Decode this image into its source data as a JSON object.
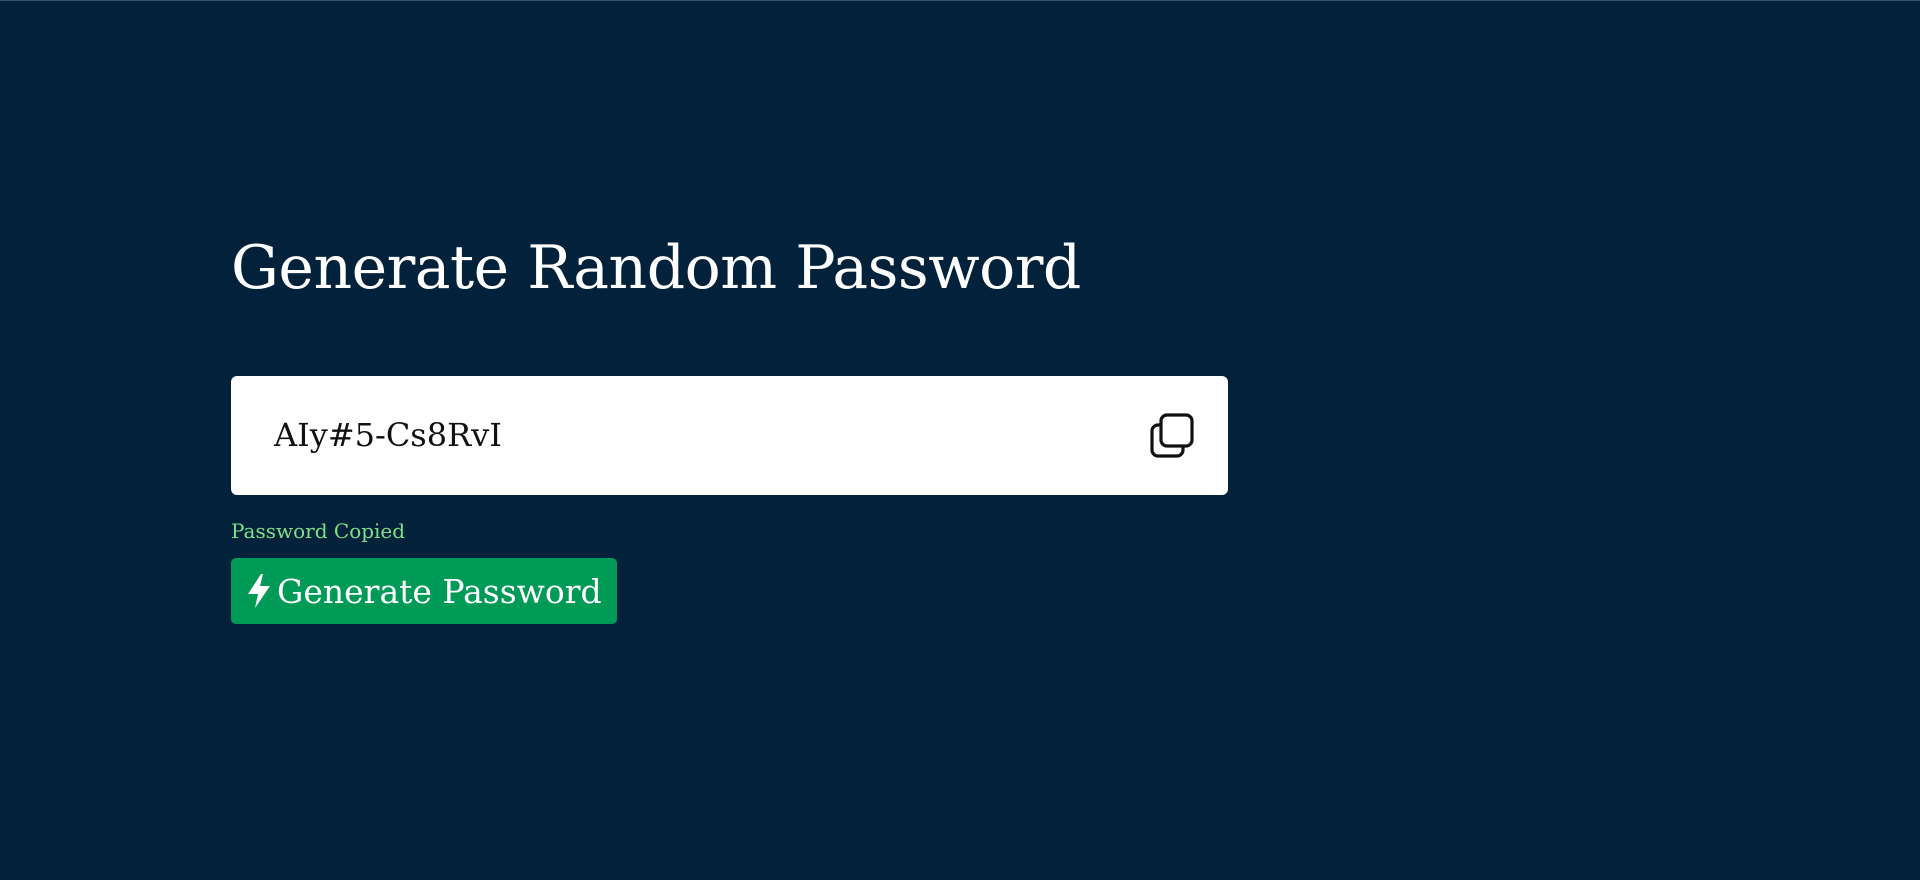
{
  "page": {
    "title": "Generate Random Password"
  },
  "password": {
    "value": "AIy#5-Cs8RvI",
    "copy_icon": "copy-icon"
  },
  "status": {
    "message": "Password Copied",
    "color": "#7fe08a"
  },
  "generate_button": {
    "label": "Generate Password",
    "icon": "lightning-bolt-icon",
    "color": "#009a57"
  },
  "colors": {
    "background": "#01223a",
    "card": "#ffffff",
    "text": "#ffffff"
  }
}
